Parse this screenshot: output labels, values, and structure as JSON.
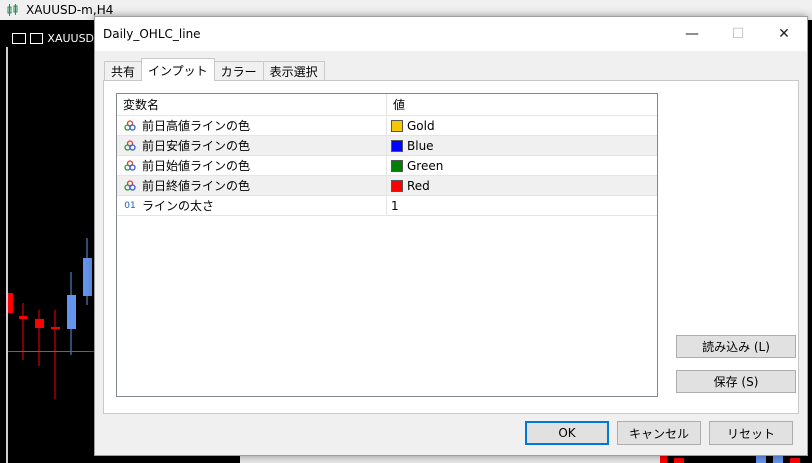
{
  "background_window": {
    "title": "XAUUSD-m,H4",
    "chart_tab_label": "XAUUSD-"
  },
  "dialog": {
    "title": "Daily_OHLC_line",
    "window_buttons": {
      "minimize": "—",
      "maximize": "☐",
      "close": "✕"
    },
    "tabs": [
      {
        "label": "共有",
        "active": false
      },
      {
        "label": "インプット",
        "active": true
      },
      {
        "label": "カラー",
        "active": false
      },
      {
        "label": "表示選択",
        "active": false
      }
    ],
    "table": {
      "headers": {
        "name": "変数名",
        "value": "値"
      },
      "rows": [
        {
          "type": "color",
          "icon": "color-input-icon",
          "name": "前日高値ラインの色",
          "value": "Gold",
          "swatch": "#f5c800"
        },
        {
          "type": "color",
          "icon": "color-input-icon",
          "name": "前日安値ラインの色",
          "value": "Blue",
          "swatch": "#0000ff"
        },
        {
          "type": "color",
          "icon": "color-input-icon",
          "name": "前日始値ラインの色",
          "value": "Green",
          "swatch": "#008000"
        },
        {
          "type": "color",
          "icon": "color-input-icon",
          "name": "前日終値ラインの色",
          "value": "Red",
          "swatch": "#ff0000"
        },
        {
          "type": "int",
          "icon": "integer-input-icon",
          "type_text": "01",
          "name": "ラインの太さ",
          "value": "1"
        }
      ]
    },
    "side_buttons": {
      "load": "読み込み (L)",
      "save": "保存 (S)"
    },
    "footer_buttons": {
      "ok": "OK",
      "cancel": "キャンセル",
      "reset": "リセット"
    }
  },
  "colors": {
    "accent_focus": "#0078d7",
    "candle_up": "#6495ed",
    "candle_down": "#ff0000"
  }
}
